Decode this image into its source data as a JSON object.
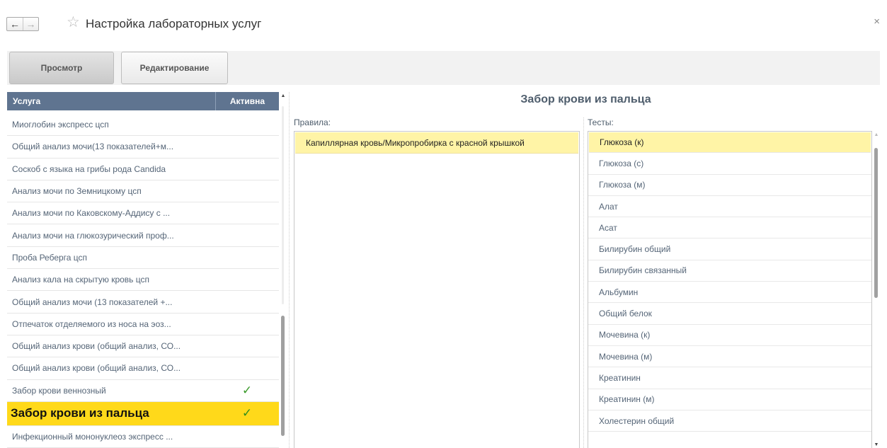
{
  "window": {
    "title": "Настройка лабораторных услуг",
    "back_glyph": "←",
    "forward_glyph": "→",
    "favorite_glyph": "☆",
    "close_glyph": "×"
  },
  "toolbar": {
    "view_label": "Просмотр",
    "edit_label": "Редактирование"
  },
  "services": {
    "col_service": "Услуга",
    "col_active": "Активна",
    "items": [
      {
        "name": "Миоглобин экспресс цсп",
        "active": ""
      },
      {
        "name": "Общий анализ мочи(13 показателей+м...",
        "active": ""
      },
      {
        "name": "Соскоб с языка на грибы рода Candida",
        "active": ""
      },
      {
        "name": "Анализ мочи по Земницкому цсп",
        "active": ""
      },
      {
        "name": "Анализ мочи по Каковскому-Аддису с ...",
        "active": ""
      },
      {
        "name": " Анализ мочи на глюкозурический проф...",
        "active": ""
      },
      {
        "name": "Проба Реберга цсп",
        "active": ""
      },
      {
        "name": "Анализ кала на скрытую кровь цсп",
        "active": ""
      },
      {
        "name": "Общий анализ мочи  (13 показателей +...",
        "active": ""
      },
      {
        "name": "Отпечаток отделяемого из носа на эоз...",
        "active": ""
      },
      {
        "name": "Общий анализ крови (общий анализ, СО...",
        "active": ""
      },
      {
        "name": "Общий анализ крови (общий анализ, СО...",
        "active": ""
      },
      {
        "name": "Забор крови веннозный",
        "active": "✓"
      },
      {
        "name": "Забор крови из пальца",
        "active": "✓"
      },
      {
        "name": "Инфекционный мононуклеоз экспресс ...",
        "active": ""
      }
    ]
  },
  "detail": {
    "title": "Забор крови из пальца",
    "rules_label": "Правила:",
    "tests_label": "Тесты:",
    "rules": [
      "Капиллярная кровь/Микропробирка с красной крышкой"
    ],
    "tests": [
      "Глюкоза (к)",
      "Глюкоза (с)",
      "Глюкоза (м)",
      "Алат",
      "Асат",
      "Билирубин общий",
      "Билирубин связанный",
      "Альбумин",
      "Общий белок",
      "Мочевина (к)",
      "Мочевина (м)",
      "Креатинин",
      "Креатинин (м)",
      "Холестерин общий"
    ]
  },
  "colors": {
    "header_bg": "#5f7490",
    "selected_row": "#ffd91a",
    "selected_light": "#fff4a6",
    "checkmark": "#3a9a2a"
  }
}
